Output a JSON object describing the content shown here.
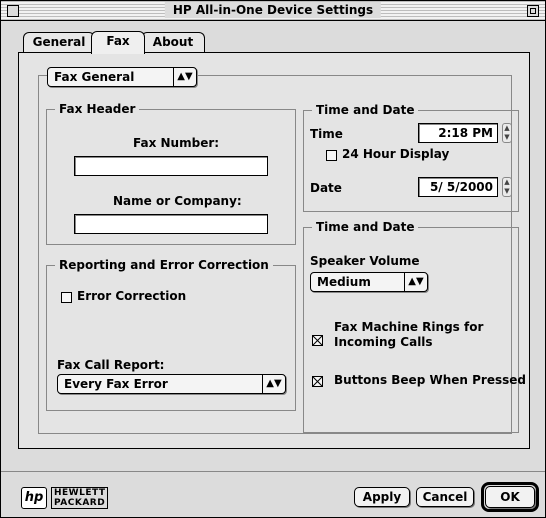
{
  "window": {
    "title": "HP All-in-One Device Settings"
  },
  "tabs": [
    {
      "label": "General"
    },
    {
      "label": "Fax",
      "active": true
    },
    {
      "label": "About"
    }
  ],
  "section_popup": {
    "selected": "Fax General"
  },
  "fax_header": {
    "title": "Fax Header",
    "fax_number_label": "Fax Number:",
    "fax_number_value": "",
    "name_label": "Name or Company:",
    "name_value": ""
  },
  "reporting": {
    "title": "Reporting and Error Correction",
    "error_correction_label": "Error Correction",
    "error_correction_checked": false,
    "call_report_label": "Fax Call Report:",
    "call_report_selected": "Every Fax Error"
  },
  "time_date": {
    "title": "Time and Date",
    "time_label": "Time",
    "time_value": "2:18 PM",
    "hour24_label": "24 Hour Display",
    "hour24_checked": false,
    "date_label": "Date",
    "date_value": "5/ 5/2000"
  },
  "sound": {
    "title": "Time and Date",
    "speaker_label": "Speaker Volume",
    "speaker_selected": "Medium",
    "rings_label_line1": "Fax Machine Rings for",
    "rings_label_line2": "Incoming Calls",
    "rings_checked": true,
    "beep_label": "Buttons Beep When Pressed",
    "beep_checked": true
  },
  "footer": {
    "logo_mark": "hp",
    "logo_line1": "HEWLETT",
    "logo_line2": "PACKARD",
    "apply_label": "Apply",
    "cancel_label": "Cancel",
    "ok_label": "OK"
  },
  "icons": {
    "popup_arrows": "updown-arrows-icon",
    "stepper": "stepper-arrows-icon"
  }
}
